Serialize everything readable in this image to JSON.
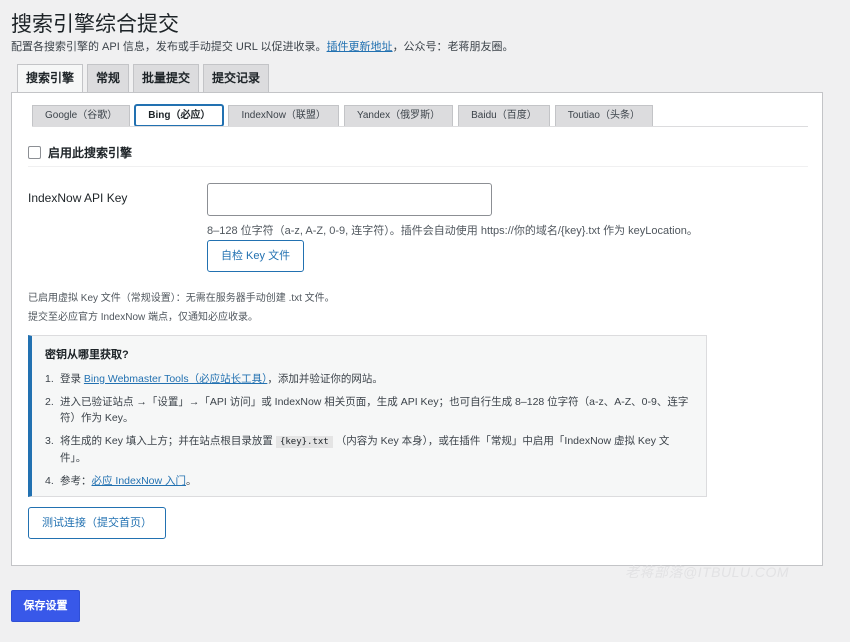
{
  "header": {
    "title": "搜索引擎综合提交",
    "description": "配置各搜索引擎的 API 信息，发布或手动提交 URL 以促进收录。",
    "link_text": "插件更新地址",
    "description_suffix": "，公众号：老蒋朋友圈。"
  },
  "main_tabs": [
    {
      "label": "搜索引擎",
      "active": true
    },
    {
      "label": "常规",
      "active": false
    },
    {
      "label": "批量提交",
      "active": false
    },
    {
      "label": "提交记录",
      "active": false
    }
  ],
  "engine_tabs": [
    {
      "label": "Google（谷歌）",
      "active": false
    },
    {
      "label": "Bing（必应）",
      "active": true
    },
    {
      "label": "IndexNow（联盟）",
      "active": false
    },
    {
      "label": "Yandex（俄罗斯）",
      "active": false
    },
    {
      "label": "Baidu（百度）",
      "active": false
    },
    {
      "label": "Toutiao（头条）",
      "active": false
    }
  ],
  "enable": {
    "label": "启用此搜索引擎",
    "checked": false
  },
  "indexnow_key": {
    "label": "IndexNow API Key",
    "value": "",
    "hint": "8–128 位字符（a-z, A-Z, 0-9, 连字符）。插件会自动使用 https://你的域名/{key}.txt 作为 keyLocation。",
    "check_button": "自检 Key 文件"
  },
  "notes": {
    "line1": "已启用虚拟 Key 文件（常规设置）：无需在服务器手动创建 .txt 文件。",
    "line2": "提交至必应官方 IndexNow 端点，仅通知必应收录。"
  },
  "info_box": {
    "title": "密钥从哪里获取?",
    "items": {
      "i1_num": "1.",
      "i1_prefix": "登录 ",
      "i1_link": "Bing Webmaster Tools（必应站长工具）",
      "i1_suffix": "，添加并验证你的网站。",
      "i2_num": "2.",
      "i2_text": "进入已验证站点 →「设置」→「API 访问」或 IndexNow 相关页面，生成 API Key；也可自行生成 8–128 位字符（a-z、A-Z、0-9、连字符）作为 Key。",
      "i3_num": "3.",
      "i3_prefix": "将生成的 Key 填入上方；并在站点根目录放置",
      "i3_code": "{key}.txt",
      "i3_suffix": "（内容为 Key 本身），或在插件「常规」中启用「IndexNow 虚拟 Key 文件」。",
      "i4_num": "4.",
      "i4_prefix": "参考：",
      "i4_link": "必应 IndexNow 入门",
      "i4_suffix": "。"
    }
  },
  "test_button": "测试连接（提交首页）",
  "watermark": "老蒋部落@ITBULU.COM",
  "save_button": "保存设置"
}
